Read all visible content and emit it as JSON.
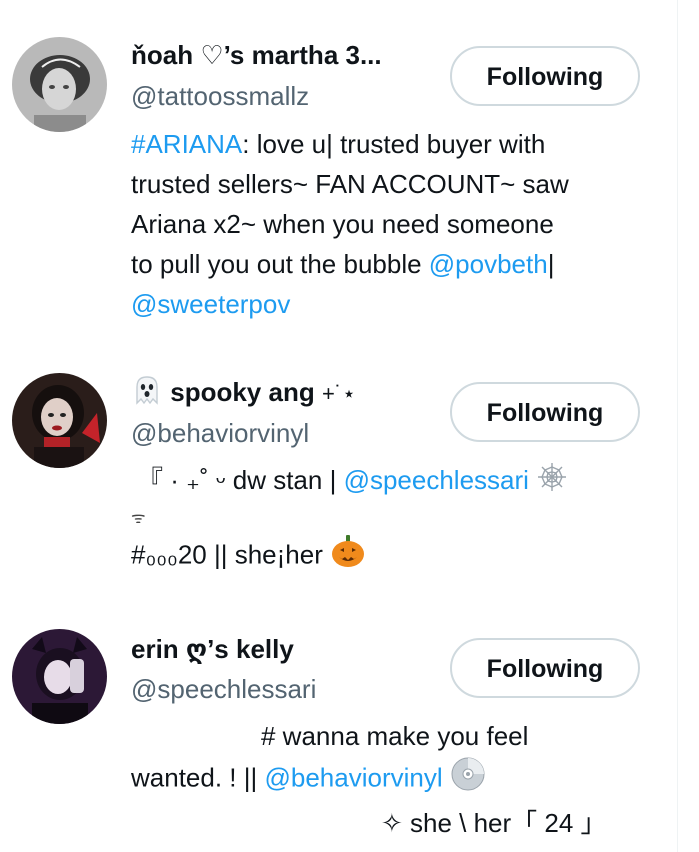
{
  "users": [
    {
      "display_name": "ňoah ♡’s martha 3...",
      "handle": "@tattoossmallz",
      "button_label": "Following",
      "bio": {
        "hashtag": "#ARIANA",
        "l1_rest": ": love u| trusted buyer with",
        "l2": "trusted sellers~ FAN ACCOUNT~ saw",
        "l3": "Ariana x2~ when you need someone",
        "l4_pre": "to pull you out the bubble ",
        "mention1": "@povbeth",
        "l4_post": "|",
        "mention2": "@sweeterpov"
      }
    },
    {
      "display_name_emoji": "ghost-emoji",
      "display_name": "spooky ang",
      "display_name_suffix": "+˙⋆",
      "handle": "@behaviorvinyl",
      "button_label": "Following",
      "bio": {
        "l1_pre": "『 · ₊˚ ᵕ dw stan | ",
        "mention": "@speechlessari",
        "l1_emoji": "spider-web-emoji",
        "l2": "ᯤ",
        "l3": "#₀₀₀20 || she¡her",
        "l3_emoji": "jack-o-lantern-emoji"
      }
    },
    {
      "display_name": "erin ღ’s kelly",
      "handle": "@speechlessari",
      "button_label": "Following",
      "bio": {
        "l1": "# wanna make you feel",
        "l2_pre": "wanted. ! || ",
        "mention": "@behaviorvinyl",
        "l2_emoji": "disc-emoji",
        "l3": "✧ she \\ her「 24 」"
      }
    }
  ],
  "colors": {
    "link": "#1d9bf0",
    "text": "#0f1419",
    "secondary": "#536471",
    "button_border": "#cfd9de"
  }
}
